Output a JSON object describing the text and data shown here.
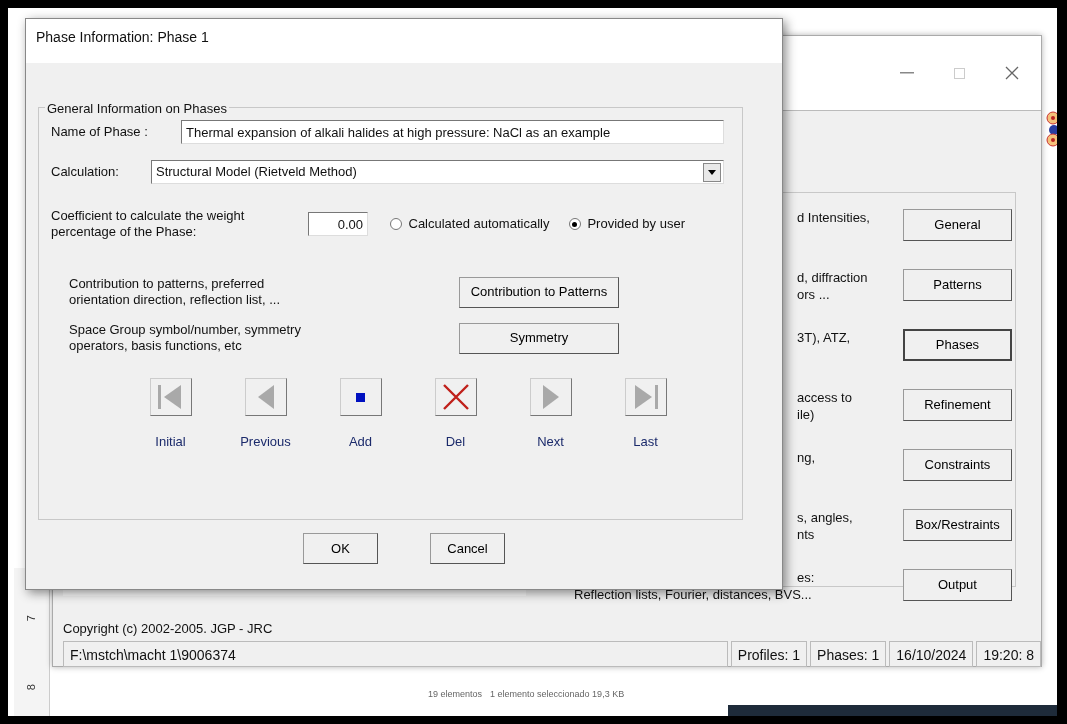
{
  "main_window": {
    "rows": [
      {
        "lines": [
          "d Intensities,"
        ],
        "button": "General",
        "selected": false
      },
      {
        "lines": [
          "d, diffraction",
          "ors ..."
        ],
        "button": "Patterns",
        "selected": false
      },
      {
        "lines": [
          "3T),  ATZ,"
        ],
        "button": "Phases",
        "selected": true
      },
      {
        "lines": [
          "access to",
          "ile)"
        ],
        "button": "Refinement",
        "selected": false
      },
      {
        "lines": [
          "ng,"
        ],
        "button": "Constraints",
        "selected": false
      },
      {
        "lines": [
          "s, angles,",
          "nts"
        ],
        "button": "Box/Restraints",
        "selected": false
      },
      {
        "lines": [
          "es:",
          "Reflection lists, Fourier, distances, BVS..."
        ],
        "button": "Output",
        "selected": false
      }
    ],
    "copyright": "Copyright (c) 2002-2005. JGP - JRC",
    "status_bar": [
      "F:\\mstch\\macht 1\\9006374",
      "Profiles: 1",
      "Phases: 1",
      "16/10/2024",
      "19:20: 8"
    ]
  },
  "ruler": [
    "7",
    "8"
  ],
  "explorer_status": [
    "19 elementos",
    "1 elemento seleccionado 19,3 KB"
  ],
  "dialog": {
    "title": "Phase Information: Phase 1",
    "group_title": "General Information on Phases",
    "name_label": "Name of Phase :",
    "name_value": "Thermal expansion of alkali halides at high pressure: NaCl as an example",
    "calc_label": "Calculation:",
    "calc_value": "Structural Model (Rietveld Method)",
    "coef_label": "Coefficient to calculate the weight percentage of the Phase:",
    "coef_value": "0.00",
    "radios": [
      {
        "label": "Calculated automatically",
        "selected": false
      },
      {
        "label": "Provided by user",
        "selected": true
      }
    ],
    "actions": [
      {
        "description": "Contribution to patterns, preferred orientation direction, reflection list, ...",
        "button": "Contribution to Patterns"
      },
      {
        "description": "Space Group symbol/number, symmetry operators, basis functions, etc",
        "button": "Symmetry"
      }
    ],
    "nav": [
      {
        "kind": "first",
        "label": "Initial"
      },
      {
        "kind": "prev",
        "label": "Previous"
      },
      {
        "kind": "add",
        "label": "Add"
      },
      {
        "kind": "delete",
        "label": "Del"
      },
      {
        "kind": "next",
        "label": "Next"
      },
      {
        "kind": "last",
        "label": "Last"
      }
    ],
    "buttons": [
      "OK",
      "Cancel"
    ]
  }
}
